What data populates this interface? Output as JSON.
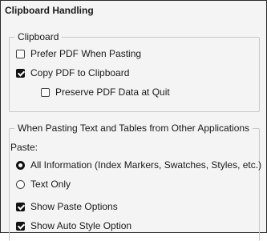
{
  "dialog": {
    "title": "Clipboard Handling"
  },
  "clipboard_group": {
    "legend": "Clipboard",
    "prefer_pdf": {
      "label": "Prefer PDF When Pasting",
      "checked": false
    },
    "copy_pdf": {
      "label": "Copy PDF to Clipboard",
      "checked": true
    },
    "preserve_pdf": {
      "label": "Preserve PDF Data at Quit",
      "checked": false
    }
  },
  "paste_group": {
    "legend": "When Pasting Text and Tables from Other Applications",
    "paste_label": "Paste:",
    "all_information": {
      "label": "All Information (Index Markers, Swatches, Styles, etc.)",
      "selected": true
    },
    "text_only": {
      "label": "Text Only",
      "selected": false
    },
    "show_paste_options": {
      "label": "Show Paste Options",
      "checked": true
    },
    "show_auto_style": {
      "label": "Show Auto Style Option",
      "checked": true
    }
  }
}
